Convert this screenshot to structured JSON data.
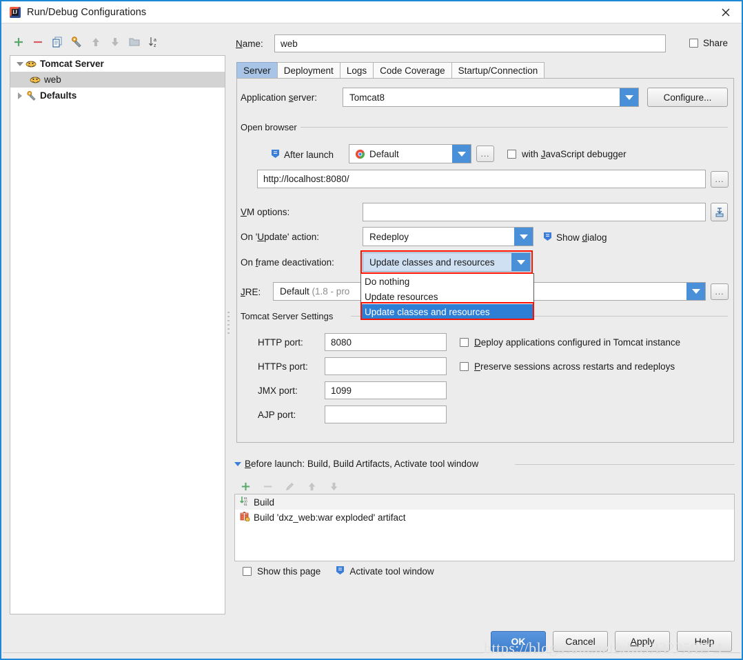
{
  "window": {
    "title": "Run/Debug Configurations",
    "app_icon": "intellij-idea-icon",
    "close_label": "✕"
  },
  "left_panel": {
    "toolbar": [
      {
        "name": "add-configuration-button",
        "icon": "plus-icon",
        "title": "Add New Configuration"
      },
      {
        "name": "remove-configuration-button",
        "icon": "minus-icon",
        "title": "Remove Configuration"
      },
      {
        "name": "copy-configuration-button",
        "icon": "copy-icon",
        "title": "Copy Configuration"
      },
      {
        "name": "edit-defaults-button",
        "icon": "wrench-icon",
        "title": "Edit defaults"
      },
      {
        "name": "move-up-button",
        "icon": "arrow-up-icon",
        "title": "Move Up"
      },
      {
        "name": "move-down-button",
        "icon": "arrow-down-icon",
        "title": "Move Down"
      },
      {
        "name": "create-folder-button",
        "icon": "folder-icon",
        "title": "Create New Folder"
      },
      {
        "name": "sort-button",
        "icon": "sort-az-icon",
        "title": "Sort Configurations"
      }
    ],
    "tree": [
      {
        "label": "Tomcat Server",
        "icon": "tomcat-icon",
        "expander": "down",
        "bold": true,
        "selected": false,
        "indent": 0
      },
      {
        "label": "web",
        "icon": "tomcat-icon",
        "expander": "none",
        "bold": false,
        "selected": true,
        "indent": 1
      },
      {
        "label": "Defaults",
        "icon": "wrench-icon",
        "expander": "right",
        "bold": true,
        "selected": false,
        "indent": 0
      }
    ]
  },
  "header": {
    "name_label": "Name:",
    "name_value": "web",
    "share_label": "Share",
    "share_checked": false
  },
  "tabs": [
    {
      "label": "Server",
      "active": true
    },
    {
      "label": "Deployment",
      "active": false
    },
    {
      "label": "Logs",
      "active": false
    },
    {
      "label": "Code Coverage",
      "active": false
    },
    {
      "label": "Startup/Connection",
      "active": false
    }
  ],
  "server_tab": {
    "application_server": {
      "label": "Application server:",
      "value": "Tomcat8",
      "configure_button": "Configure..."
    },
    "open_browser": {
      "group_title": "Open browser",
      "after_launch_label": "After launch",
      "after_launch_icon": "run-config-icon",
      "browser_value": "Default",
      "browser_icon": "chrome-icon",
      "browse_ellipsis": "...",
      "js_debugger_label": "with JavaScript debugger",
      "js_debugger_checked": false,
      "url_value": "http://localhost:8080/",
      "url_ellipsis": "..."
    },
    "vm_options": {
      "label": "VM options:",
      "value": "",
      "expand_button_icon": "expand-editor-icon"
    },
    "on_update_action": {
      "label": "On 'Update' action:",
      "value": "Redeploy",
      "show_dialog_label": "Show dialog",
      "show_dialog_icon": "run-config-icon",
      "show_dialog_checked": false
    },
    "on_frame_deactivation": {
      "label": "On frame deactivation:",
      "value": "Update classes and resources",
      "expanded": true,
      "options": [
        {
          "label": "Do nothing",
          "selected": false
        },
        {
          "label": "Update resources",
          "selected": false
        },
        {
          "label": "Update classes and resources",
          "selected": true
        }
      ]
    },
    "jre": {
      "label": "JRE:",
      "value": "Default",
      "value_hint": "(1.8 - pro",
      "ellipsis": "..."
    },
    "tomcat_settings": {
      "group_title": "Tomcat Server Settings",
      "fields": [
        {
          "label": "HTTP port:",
          "value": "8080",
          "name": "http-port-input"
        },
        {
          "label": "HTTPs port:",
          "value": "",
          "name": "https-port-input"
        },
        {
          "label": "JMX port:",
          "value": "1099",
          "name": "jmx-port-input"
        },
        {
          "label": "AJP port:",
          "value": "",
          "name": "ajp-port-input"
        }
      ],
      "checkboxes": [
        {
          "label": "Deploy applications configured in Tomcat instance",
          "checked": false,
          "mnemonic": "D",
          "name": "deploy-applications-checkbox"
        },
        {
          "label": "Preserve sessions across restarts and redeploys",
          "checked": false,
          "mnemonic": "P",
          "name": "preserve-sessions-checkbox"
        }
      ]
    }
  },
  "before_launch": {
    "header": "Before launch: Build, Build Artifacts, Activate tool window",
    "toolbar": [
      {
        "name": "before-launch-add-button",
        "icon": "plus-icon",
        "enabled": true
      },
      {
        "name": "before-launch-remove-button",
        "icon": "minus-icon",
        "enabled": false
      },
      {
        "name": "before-launch-edit-button",
        "icon": "pencil-icon",
        "enabled": false
      },
      {
        "name": "before-launch-move-up-button",
        "icon": "arrow-up-icon",
        "enabled": false
      },
      {
        "name": "before-launch-move-down-button",
        "icon": "arrow-down-icon",
        "enabled": false
      }
    ],
    "items": [
      {
        "label": "Build",
        "icon": "build-icon",
        "selected": true
      },
      {
        "label": "Build 'dxz_web:war exploded' artifact",
        "icon": "artifact-icon",
        "selected": false
      }
    ],
    "show_this_page_label": "Show this page",
    "show_this_page_checked": false,
    "activate_tool_window_label": "Activate tool window",
    "activate_tool_window_icon": "run-config-icon"
  },
  "footer": {
    "buttons": [
      {
        "label": "OK",
        "primary": true,
        "name": "ok-button"
      },
      {
        "label": "Cancel",
        "primary": false,
        "name": "cancel-button"
      },
      {
        "label": "Apply",
        "primary": false,
        "name": "apply-button"
      },
      {
        "label": "Help",
        "primary": false,
        "name": "help-button"
      }
    ]
  },
  "watermark": "https://blog.csdn.net/xlm1332259724",
  "colors": {
    "window_border": "#1e87d6",
    "accent_blue": "#4a90d9",
    "selection_blue": "#2d7fd6",
    "active_tab": "#a8c5e8",
    "highlight_red": "#fb1100",
    "panel_bg": "#ececec"
  }
}
